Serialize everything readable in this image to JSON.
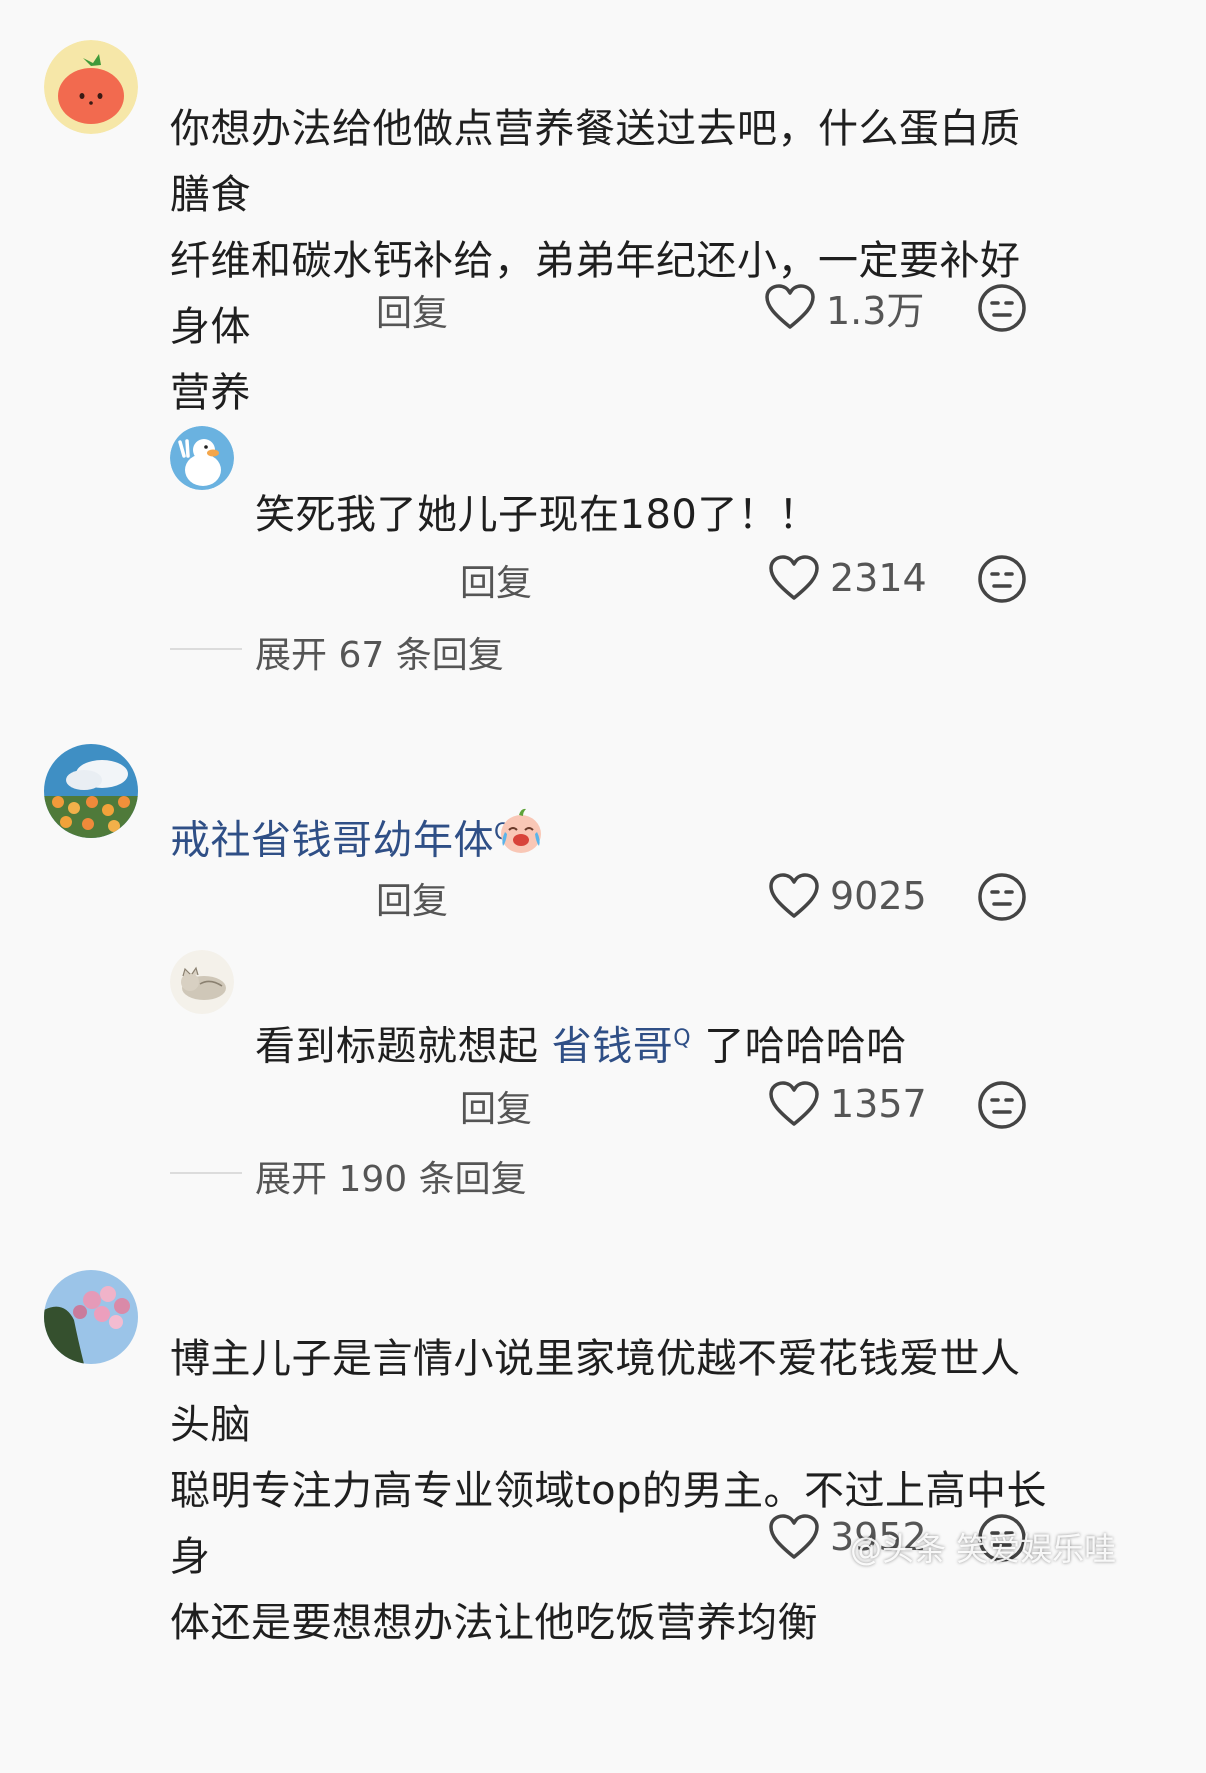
{
  "comments": [
    {
      "text": "你想办法给他做点营养餐送过去吧，什么蛋白质膳食纤维和碳水钙补给，弟弟年纪还小，一定要补好身体营养",
      "lines": [
        "你想办法给他做点营养餐送过去吧，什么蛋白质膳食",
        "纤维和碳水钙补给，弟弟年纪还小，一定要补好身体",
        "营养"
      ],
      "reply_label": "回复",
      "likes": "1.3万",
      "avatar_icon": "tomato-avatar"
    },
    {
      "text": "笑死我了她儿子现在180了！！",
      "reply_label": "回复",
      "likes": "2314",
      "avatar_icon": "duck-avatar",
      "expand_label": "展开 67 条回复"
    },
    {
      "link_text": "戒社省钱哥幼年体",
      "link_marker": "Q",
      "reply_label": "回复",
      "likes": "9025",
      "avatar_icon": "flowers-sky-avatar",
      "emoji_icon": "crying-laughing-sticker-icon"
    },
    {
      "text_before": "看到标题就想起 ",
      "link_text": "省钱哥",
      "link_marker": "Q",
      "text_after": " 了哈哈哈哈",
      "reply_label": "回复",
      "likes": "1357",
      "avatar_icon": "cat-avatar",
      "expand_label": "展开 190 条回复"
    },
    {
      "lines": [
        "博主儿子是言情小说里家境优越不爱花钱爱世人头脑",
        "聪明专注力高专业领域top的男主。不过上高中长身",
        "体还是要想想办法让他吃饭营养均衡"
      ],
      "likes": "3952",
      "avatar_icon": "tree-balloons-avatar"
    }
  ],
  "watermark": "@头条 笑爱娱乐哇",
  "colors": {
    "background": "#f9f9f9",
    "link": "#2f4f86",
    "muted_text": "#555555"
  }
}
